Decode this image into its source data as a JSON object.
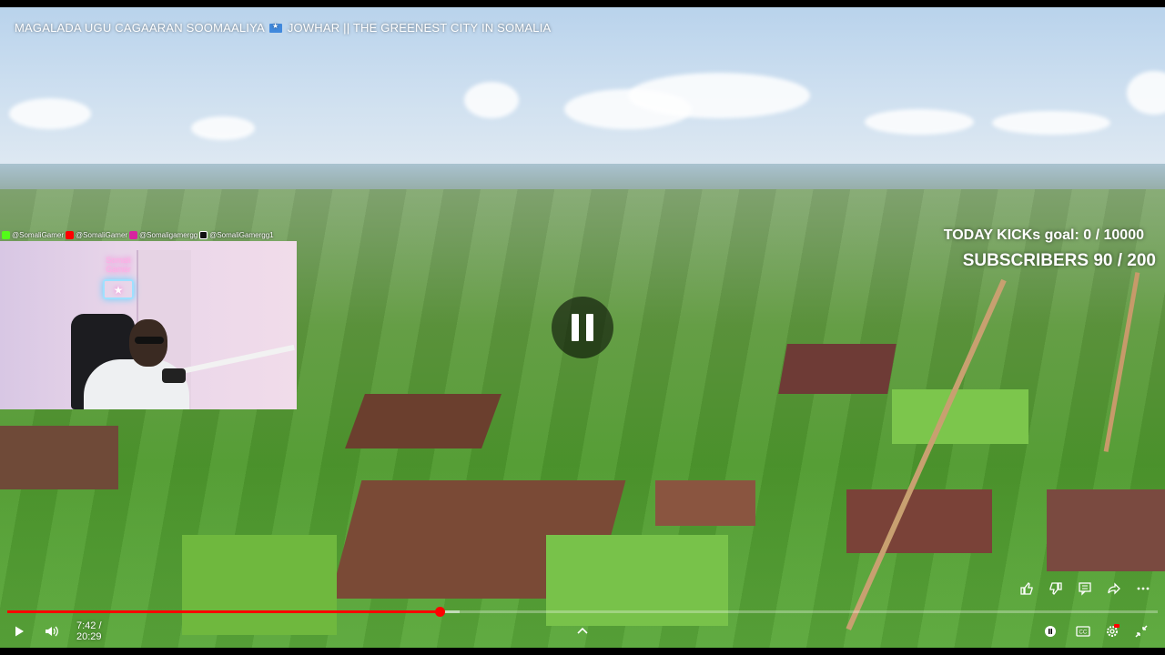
{
  "video": {
    "title_part1": "MAGALADA UGU CAGAARAN SOOMAALIYA",
    "title_flag_icon": "somalia-flag-icon",
    "title_part2": "JOWHAR || THE GREENEST CITY IN SOMALIA"
  },
  "overlay": {
    "kicks_goal": "TODAY KICKs goal: 0 / 10000",
    "subscribers_goal": "SUBSCRIBERS 90 / 200"
  },
  "social": [
    {
      "icon": "kick-icon",
      "color": "#53fc18",
      "handle": "@SomaliGamer"
    },
    {
      "icon": "youtube-icon",
      "color": "#ff0000",
      "handle": "@SomaliGamer"
    },
    {
      "icon": "instagram-icon",
      "color": "#d6249f",
      "handle": "@Somaligamergg"
    },
    {
      "icon": "tiktok-icon",
      "color": "#111111",
      "handle": "@SomaliGamergg1"
    }
  ],
  "webcam": {
    "neon_sign": "Somali Gamer"
  },
  "player": {
    "state": "paused",
    "current_time": "7:42",
    "duration": "20:29",
    "time_display": "7:42 / 20:29",
    "progress": 0.376,
    "buffered": 0.393,
    "accent_color": "#ff0000"
  },
  "actions": [
    "like-icon",
    "dislike-icon",
    "comments-icon",
    "share-icon",
    "more-icon"
  ],
  "controls": {
    "left": [
      "play-icon",
      "volume-icon"
    ],
    "center": [
      "chevron-up-icon"
    ],
    "right": [
      "pause-toggle-icon",
      "captions-icon",
      "settings-icon",
      "exit-fullscreen-icon"
    ]
  }
}
